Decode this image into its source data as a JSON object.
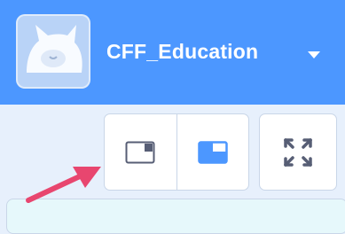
{
  "menubar": {
    "username": "CFF_Education",
    "accent_color": "#4c97ff"
  },
  "icons": {
    "avatar": "user-avatar-cat",
    "dropdown": "caret-down-icon",
    "small_stage": "small-stage-layout-icon",
    "large_stage": "large-stage-layout-icon",
    "fullscreen": "fullscreen-icon"
  },
  "annotation": {
    "arrow_color": "#e8466f"
  }
}
